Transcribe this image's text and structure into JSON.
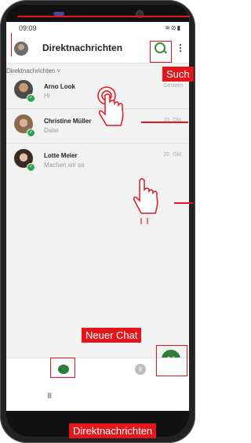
{
  "status_bar": {
    "time": "09:09",
    "icons": "≋⊘▮"
  },
  "app_bar": {
    "title": "Direktnachrichten",
    "search_icon": "search-icon",
    "menu_icon": "⋮"
  },
  "section_header": "Direktnachrichten ˅",
  "conversations": [
    {
      "name": "Arno Look",
      "preview": "Hi",
      "date": "Gestern"
    },
    {
      "name": "Christine Müller",
      "preview": "Datei",
      "date": "20. Okt."
    },
    {
      "name": "Lotte Meier",
      "preview": "Machen wir so",
      "date": "20. Okt."
    }
  ],
  "annotations": {
    "search": "Such",
    "new_chat": "Neuer Chat",
    "direct_messages": "Direktnachrichten"
  },
  "fab_glyph": "●+",
  "nav": {
    "hash_glyph": "#"
  },
  "system_nav": {
    "recent_glyph": "III"
  },
  "colors": {
    "accent_green": "#2f7d3a",
    "annotation_red": "#e4161c",
    "online_badge": "#2aa44a"
  }
}
